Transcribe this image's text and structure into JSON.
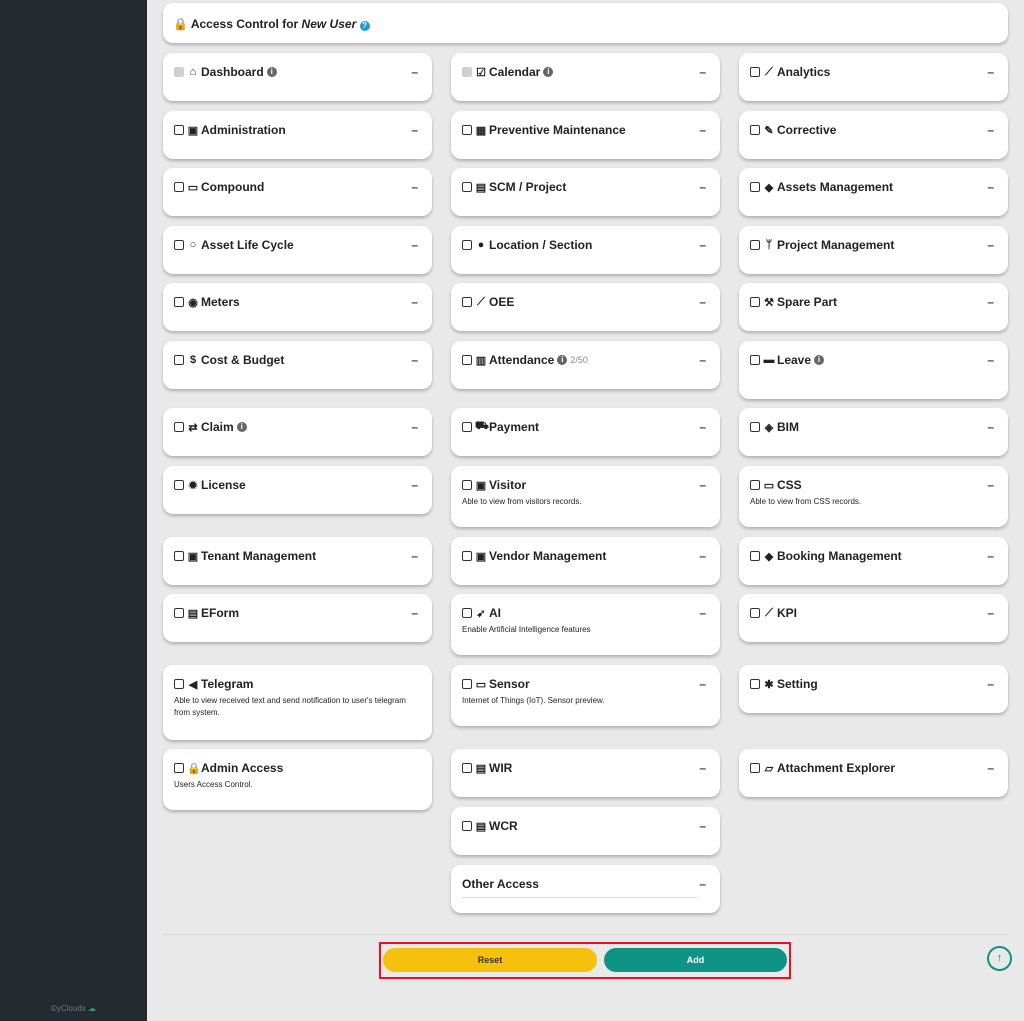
{
  "header": {
    "prefix": "Access Control for",
    "target": "New User",
    "help_icon": "question-circle-icon"
  },
  "modules": [
    {
      "name": "Dashboard",
      "icon": "home-icon",
      "glyph": "⌂",
      "disabled": true,
      "info": true
    },
    {
      "name": "Calendar",
      "icon": "calendar-check-icon",
      "glyph": "☑",
      "disabled": true,
      "info": true
    },
    {
      "name": "Analytics",
      "icon": "line-chart-icon",
      "glyph": "⟋"
    },
    {
      "name": "Administration",
      "icon": "id-badge-icon",
      "glyph": "▣"
    },
    {
      "name": "Preventive Maintenance",
      "icon": "calendar-icon",
      "glyph": "▦"
    },
    {
      "name": "Corrective",
      "icon": "wrench-icon",
      "glyph": "✎"
    },
    {
      "name": "Compound",
      "icon": "money-icon",
      "glyph": "▭"
    },
    {
      "name": "SCM / Project",
      "icon": "file-icon",
      "glyph": "▤"
    },
    {
      "name": "Assets Management",
      "icon": "tags-icon",
      "glyph": "◆"
    },
    {
      "name": "Asset Life Cycle",
      "icon": "circle-notch-icon",
      "glyph": "○"
    },
    {
      "name": "Location / Section",
      "icon": "globe-icon",
      "glyph": "●"
    },
    {
      "name": "Project Management",
      "icon": "code-branch-icon",
      "glyph": "ᛘ"
    },
    {
      "name": "Meters",
      "icon": "tachometer-icon",
      "glyph": "◉"
    },
    {
      "name": "OEE",
      "icon": "area-chart-icon",
      "glyph": "⟋"
    },
    {
      "name": "Spare Part",
      "icon": "tools-icon",
      "glyph": "⚒"
    },
    {
      "name": "Cost & Budget",
      "icon": "dollar-icon",
      "glyph": "$"
    },
    {
      "name": "Attendance",
      "icon": "building-icon",
      "glyph": "▥",
      "info": true,
      "counter": "2/50"
    },
    {
      "name": "Leave",
      "icon": "briefcase-icon",
      "glyph": "▬",
      "info": true
    },
    {
      "name": "Claim",
      "icon": "exchange-icon",
      "glyph": "⇄",
      "info": true
    },
    {
      "name": "Payment",
      "icon": "cart-icon",
      "glyph": "⛟"
    },
    {
      "name": "BIM",
      "icon": "cube-icon",
      "glyph": "◈"
    },
    {
      "name": "License",
      "icon": "certificate-icon",
      "glyph": "✹"
    },
    {
      "name": "Visitor",
      "icon": "address-card-icon",
      "glyph": "▣",
      "description": "Able to view from visitors records."
    },
    {
      "name": "CSS",
      "icon": "desktop-icon",
      "glyph": "▭",
      "description": "Able to view from CSS records."
    },
    {
      "name": "Tenant Management",
      "icon": "id-badge-icon",
      "glyph": "▣"
    },
    {
      "name": "Vendor Management",
      "icon": "address-card-icon",
      "glyph": "▣"
    },
    {
      "name": "Booking Management",
      "icon": "ticket-icon",
      "glyph": "◆"
    },
    {
      "name": "EForm",
      "icon": "file-text-icon",
      "glyph": "▤"
    },
    {
      "name": "AI",
      "icon": "rocket-icon",
      "glyph": "➶",
      "description": "Enable Artificial Intelligence features"
    },
    {
      "name": "KPI",
      "icon": "line-chart-icon",
      "glyph": "⟋"
    },
    {
      "name": "Telegram",
      "icon": "telegram-icon",
      "glyph": "◀",
      "description": "Able to view received text and send notification to user's telegram from system."
    },
    {
      "name": "Sensor",
      "icon": "desktop-icon",
      "glyph": "▭",
      "description": "Internet of Things (IoT). Sensor preview."
    },
    {
      "name": "Setting",
      "icon": "cog-icon",
      "glyph": "✱"
    },
    {
      "name": "Admin Access",
      "icon": "lock-icon",
      "glyph": "🔒",
      "description": "Users Access Control."
    },
    {
      "name": "WIR",
      "icon": "file-text-icon",
      "glyph": "▤"
    },
    {
      "name": "Attachment Explorer",
      "icon": "folder-open-icon",
      "glyph": "▱"
    },
    {
      "name": "WCR",
      "icon": "file-text-icon",
      "glyph": "▤"
    },
    {
      "name": "Other Access"
    }
  ],
  "collapse_symbol": "–",
  "buttons": {
    "reset": "Reset",
    "add": "Add"
  },
  "footer": {
    "brand": "©yCloudx",
    "icon": "cloud-icon"
  },
  "colors": {
    "reset": "#f6c10c",
    "add": "#0e9385",
    "sidebar": "#232b30",
    "highlight": "#e8131f"
  }
}
